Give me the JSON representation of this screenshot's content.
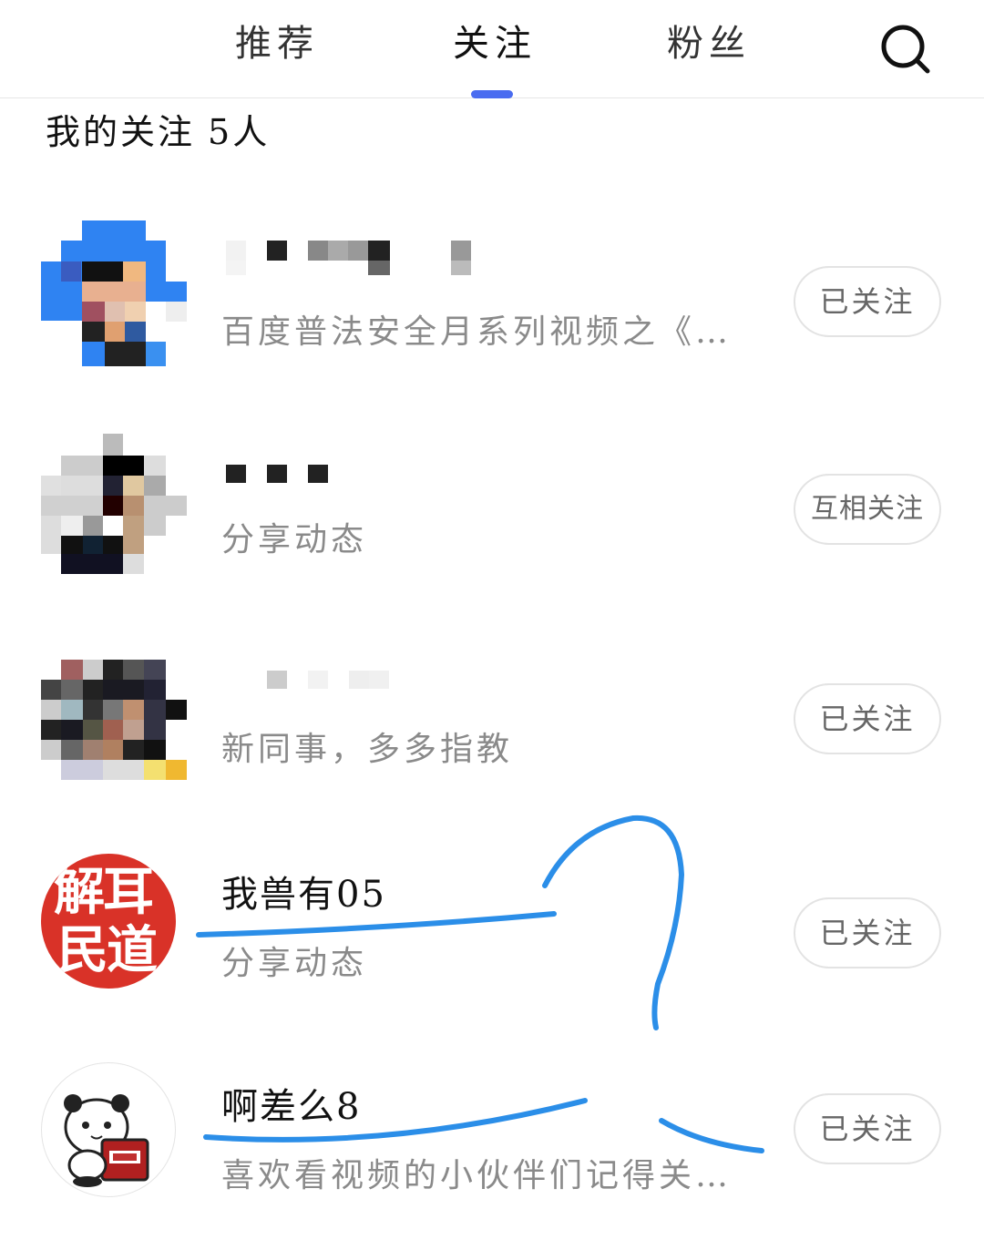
{
  "tabs": [
    {
      "label": "推荐"
    },
    {
      "label": "关注"
    },
    {
      "label": "粉丝"
    }
  ],
  "active_tab": "关注",
  "accent_color": "#4a6cf0",
  "scribble_color": "#2b8ee8",
  "section": {
    "title": "我的关注",
    "count": "5人"
  },
  "users": [
    {
      "name": "",
      "desc": "百度普法安全月系列视频之《…",
      "button": "已关注"
    },
    {
      "name": "",
      "desc": "分享动态",
      "button": "互相关注"
    },
    {
      "name": "",
      "desc": "新同事，多多指教",
      "button": "已关注"
    },
    {
      "name": "我兽有05",
      "desc": "分享动态",
      "button": "已关注",
      "avatar_text": [
        "解耳",
        "民道"
      ]
    },
    {
      "name": "啊差么8",
      "desc": "喜欢看视频的小伙伴们记得关…",
      "button": "已关注"
    }
  ],
  "icons": {
    "search": "search-icon"
  }
}
